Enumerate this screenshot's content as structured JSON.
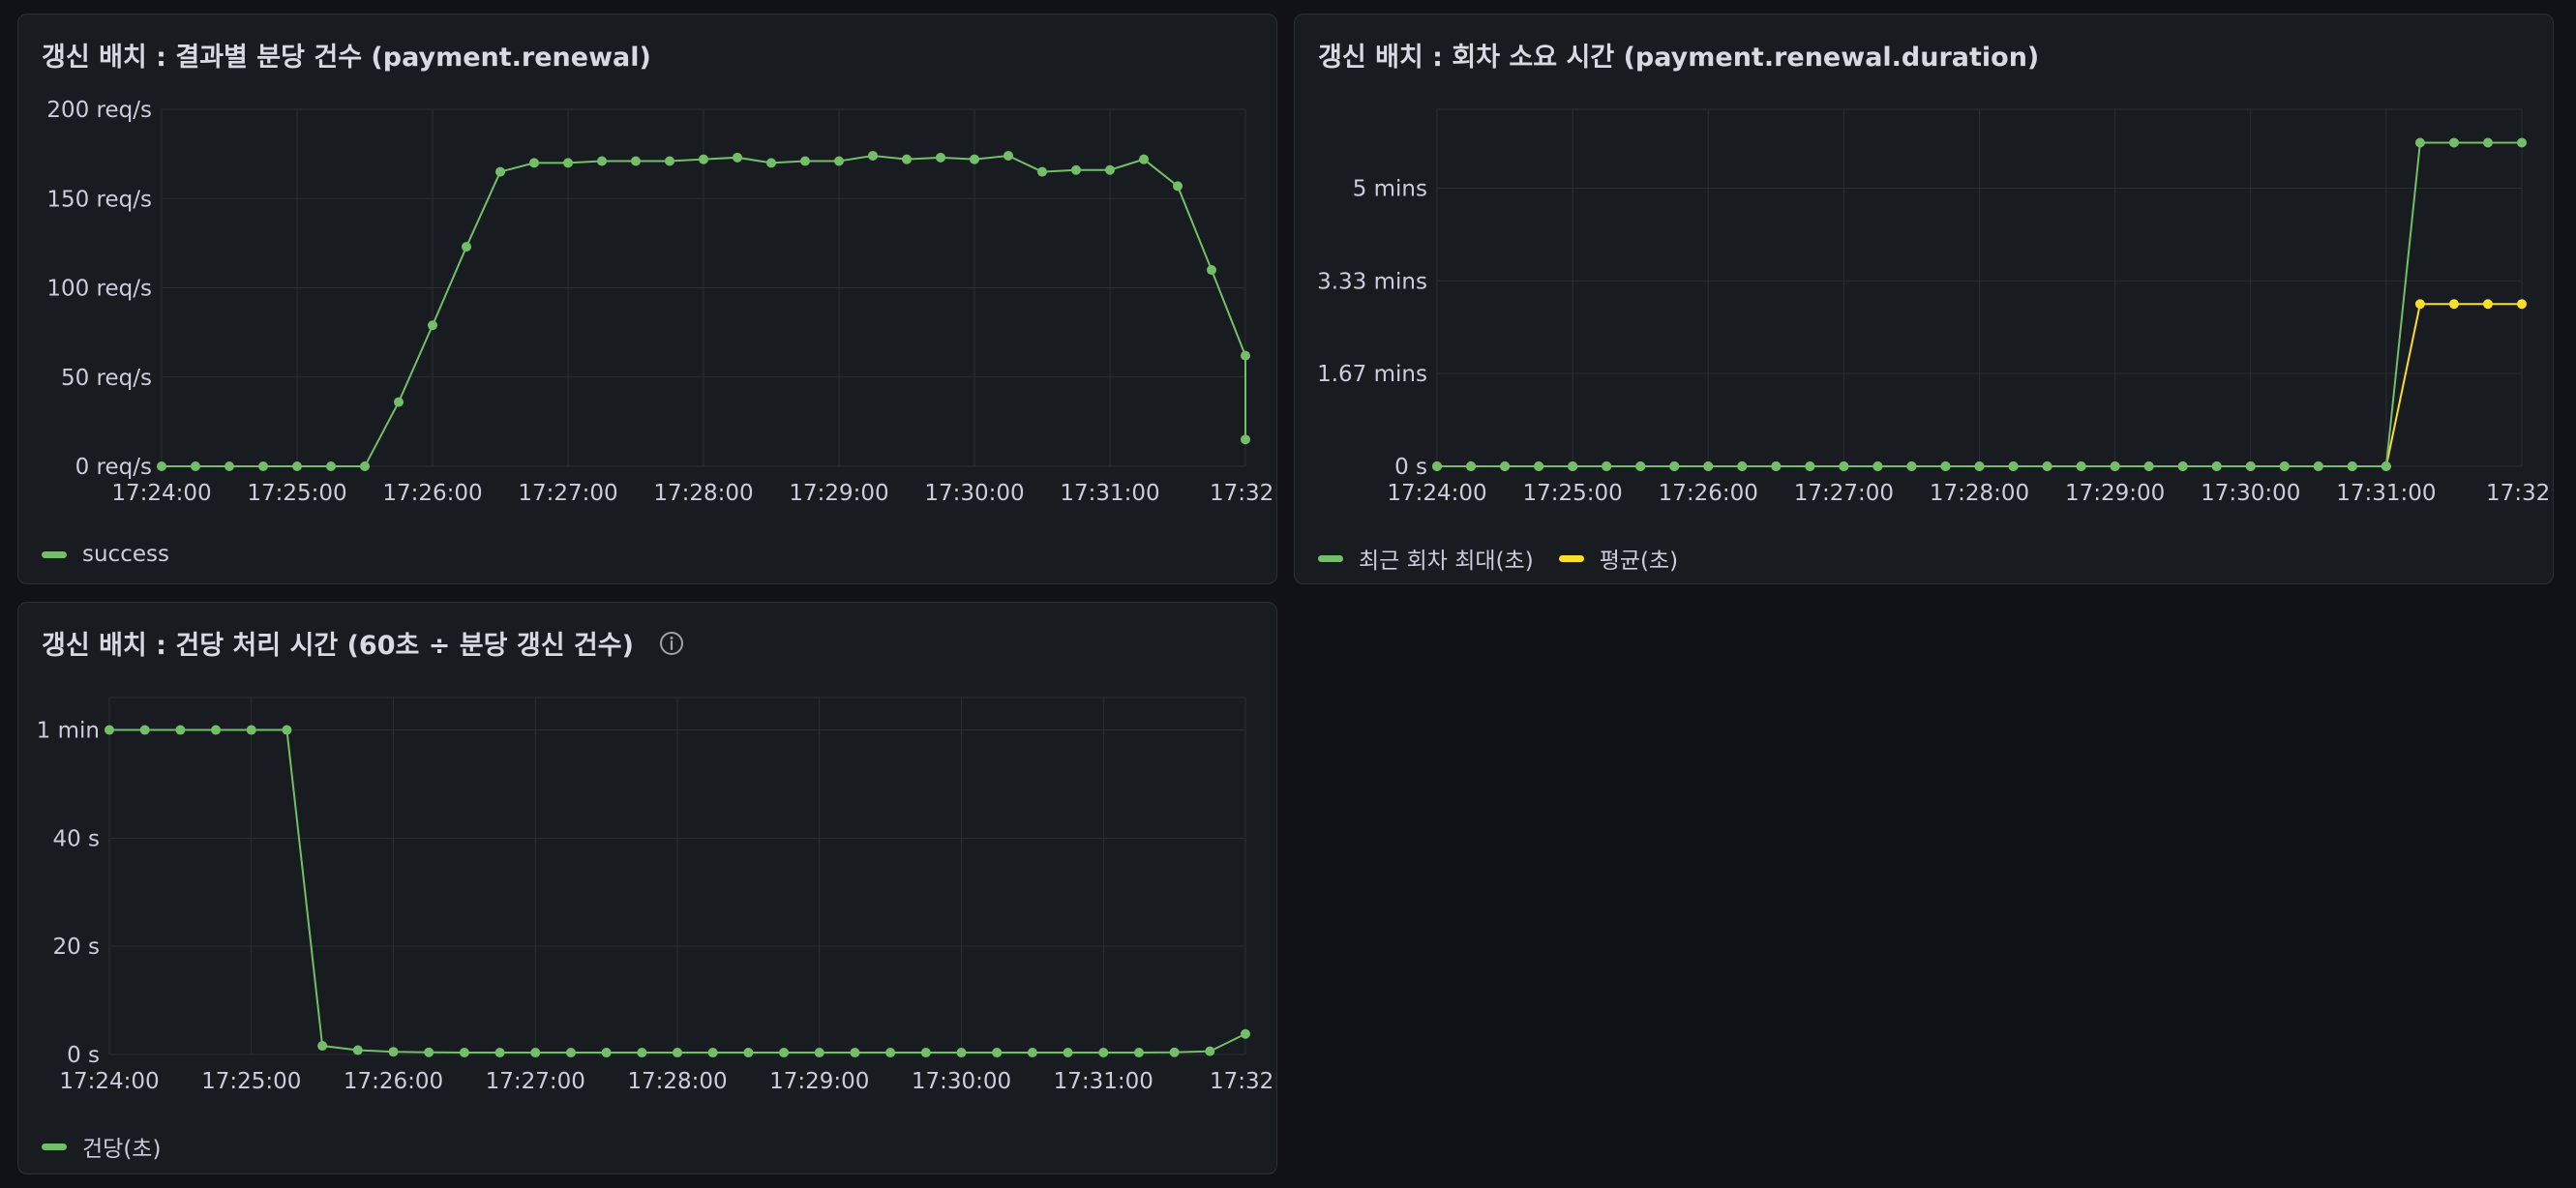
{
  "colors": {
    "green": "#73bf69",
    "yellow": "#fade2a",
    "grid": "#2a2d33",
    "text": "#ccccdc"
  },
  "panels": [
    {
      "title": "갱신 배치 : 결과별 분당 건수 (payment.renewal)",
      "info_icon": "",
      "legend": [
        {
          "label": "success",
          "color": "#73bf69"
        }
      ],
      "chart_data": {
        "type": "line",
        "x_ticks": [
          "17:24:00",
          "17:25:00",
          "17:26:00",
          "17:27:00",
          "17:28:00",
          "17:29:00",
          "17:30:00",
          "17:31:00",
          "17:32:"
        ],
        "x_tick_positions_min": [
          0,
          1,
          2,
          3,
          4,
          5,
          6,
          7,
          8
        ],
        "y_ticks": [
          {
            "value": 0,
            "label": "0 req/s"
          },
          {
            "value": 50,
            "label": "50 req/s"
          },
          {
            "value": 100,
            "label": "100 req/s"
          },
          {
            "value": 150,
            "label": "150 req/s"
          },
          {
            "value": 200,
            "label": "200 req/s"
          }
        ],
        "ylim": [
          0,
          200
        ],
        "xlim_min": [
          0,
          8
        ],
        "series": [
          {
            "name": "success",
            "color": "#73bf69",
            "x_min": [
              0,
              0.25,
              0.5,
              0.75,
              1.0,
              1.25,
              1.5,
              1.75,
              2.0,
              2.25,
              2.5,
              2.75,
              3.0,
              3.25,
              3.5,
              3.75,
              4.0,
              4.25,
              4.5,
              4.75,
              5.0,
              5.25,
              5.5,
              5.75,
              6.0,
              6.25,
              6.5,
              6.75,
              7.0,
              7.25,
              7.5,
              7.75,
              8.0
            ],
            "values": [
              0,
              0,
              0,
              0,
              0,
              0,
              0,
              36,
              79,
              123,
              165,
              170,
              170,
              171,
              171,
              171,
              172,
              173,
              170,
              171,
              171,
              174,
              172,
              173,
              172,
              174,
              165,
              166,
              166,
              172,
              157,
              110,
              62
            ]
          }
        ],
        "extra_point": {
          "x_min": 8.0,
          "value": 15
        }
      }
    },
    {
      "title": "갱신 배치 : 회차 소요 시간 (payment.renewal.duration)",
      "info_icon": "",
      "legend": [
        {
          "label": "최근 회차 최대(초)",
          "color": "#73bf69"
        },
        {
          "label": "평균(초)",
          "color": "#fade2a"
        }
      ],
      "chart_data": {
        "type": "line",
        "x_ticks": [
          "17:24:00",
          "17:25:00",
          "17:26:00",
          "17:27:00",
          "17:28:00",
          "17:29:00",
          "17:30:00",
          "17:31:00",
          "17:32:"
        ],
        "x_tick_positions_min": [
          0,
          1,
          2,
          3,
          4,
          5,
          6,
          7,
          8
        ],
        "y_ticks": [
          {
            "value": 0,
            "label": "0 s"
          },
          {
            "value": 100,
            "label": "1.67 mins"
          },
          {
            "value": 200,
            "label": "3.33 mins"
          },
          {
            "value": 300,
            "label": "5 mins"
          }
        ],
        "ylim": [
          0,
          385
        ],
        "xlim_min": [
          0,
          8
        ],
        "series": [
          {
            "name": "최근 회차 최대(초)",
            "color": "#73bf69",
            "x_min": [
              0,
              0.25,
              0.5,
              0.75,
              1.0,
              1.25,
              1.5,
              1.75,
              2.0,
              2.25,
              2.5,
              2.75,
              3.0,
              3.25,
              3.5,
              3.75,
              4.0,
              4.25,
              4.5,
              4.75,
              5.0,
              5.25,
              5.5,
              5.75,
              6.0,
              6.25,
              6.5,
              6.75,
              7.0,
              7.25,
              7.5,
              7.75,
              8.0
            ],
            "values": [
              0,
              0,
              0,
              0,
              0,
              0,
              0,
              0,
              0,
              0,
              0,
              0,
              0,
              0,
              0,
              0,
              0,
              0,
              0,
              0,
              0,
              0,
              0,
              0,
              0,
              0,
              0,
              0,
              0,
              349,
              349,
              349,
              349
            ]
          },
          {
            "name": "평균(초)",
            "color": "#fade2a",
            "x_min": [
              0,
              0.25,
              0.5,
              0.75,
              1.0,
              1.25,
              1.5,
              1.75,
              2.0,
              2.25,
              2.5,
              2.75,
              3.0,
              3.25,
              3.5,
              3.75,
              4.0,
              4.25,
              4.5,
              4.75,
              5.0,
              5.25,
              5.5,
              5.75,
              6.0,
              6.25,
              6.5,
              6.75,
              7.0,
              7.25,
              7.5,
              7.75,
              8.0
            ],
            "values": [
              0,
              0,
              0,
              0,
              0,
              0,
              0,
              0,
              0,
              0,
              0,
              0,
              0,
              0,
              0,
              0,
              0,
              0,
              0,
              0,
              0,
              0,
              0,
              0,
              0,
              0,
              0,
              0,
              0,
              175,
              175,
              175,
              175
            ]
          }
        ]
      }
    },
    {
      "title": "갱신 배치 : 건당 처리 시간 (60초 ÷ 분당 갱신 건수)",
      "info_icon": "info-circle-icon",
      "legend": [
        {
          "label": "건당(초)",
          "color": "#73bf69"
        }
      ],
      "chart_data": {
        "type": "line",
        "x_ticks": [
          "17:24:00",
          "17:25:00",
          "17:26:00",
          "17:27:00",
          "17:28:00",
          "17:29:00",
          "17:30:00",
          "17:31:00",
          "17:32:"
        ],
        "x_tick_positions_min": [
          0,
          1,
          2,
          3,
          4,
          5,
          6,
          7,
          8
        ],
        "y_ticks": [
          {
            "value": 0,
            "label": "0 s"
          },
          {
            "value": 20,
            "label": "20 s"
          },
          {
            "value": 40,
            "label": "40 s"
          },
          {
            "value": 60,
            "label": "1 min"
          }
        ],
        "ylim": [
          0,
          66
        ],
        "xlim_min": [
          0,
          8
        ],
        "series": [
          {
            "name": "건당(초)",
            "color": "#73bf69",
            "x_min": [
              0,
              0.25,
              0.5,
              0.75,
              1.0,
              1.25,
              1.5,
              1.75,
              2.0,
              2.25,
              2.5,
              2.75,
              3.0,
              3.25,
              3.5,
              3.75,
              4.0,
              4.25,
              4.5,
              4.75,
              5.0,
              5.25,
              5.5,
              5.75,
              6.0,
              6.25,
              6.5,
              6.75,
              7.0,
              7.25,
              7.5,
              7.75,
              8.0
            ],
            "values": [
              60,
              60,
              60,
              60,
              60,
              60,
              1.6,
              0.8,
              0.5,
              0.4,
              0.36,
              0.35,
              0.35,
              0.35,
              0.35,
              0.35,
              0.35,
              0.35,
              0.35,
              0.35,
              0.35,
              0.35,
              0.35,
              0.35,
              0.35,
              0.35,
              0.36,
              0.36,
              0.36,
              0.35,
              0.4,
              0.6,
              3.8
            ]
          }
        ]
      }
    }
  ]
}
